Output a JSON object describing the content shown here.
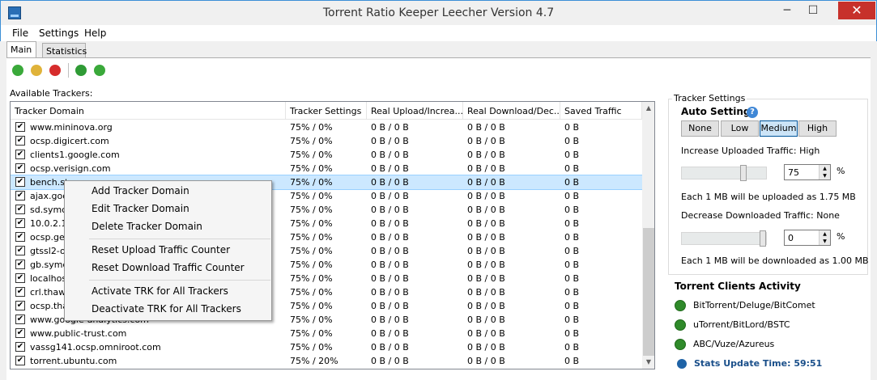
{
  "window": {
    "title": "Torrent Ratio Keeper Leecher Version 4.7",
    "minimize": "─",
    "maximize": "☐",
    "close": "✕"
  },
  "menu": [
    "File",
    "Settings",
    "Help"
  ],
  "tabs": [
    "Main",
    "Statistics"
  ],
  "available_trackers_label": "Available Trackers:",
  "table": {
    "columns": [
      "Tracker Domain",
      "Tracker Settings",
      "Real Upload/Increa...",
      "Real Download/Dec...",
      "Saved Traffic"
    ],
    "rows": [
      [
        "www.mininova.org",
        "75% / 0%",
        "0 B / 0 B",
        "0 B / 0 B",
        "0 B"
      ],
      [
        "ocsp.digicert.com",
        "75% / 0%",
        "0 B / 0 B",
        "0 B / 0 B",
        "0 B"
      ],
      [
        "clients1.google.com",
        "75% / 0%",
        "0 B / 0 B",
        "0 B / 0 B",
        "0 B"
      ],
      [
        "ocsp.verisign.com",
        "75% / 0%",
        "0 B / 0 B",
        "0 B / 0 B",
        "0 B"
      ],
      [
        "bench.st",
        "75% / 0%",
        "0 B / 0 B",
        "0 B / 0 B",
        "0 B"
      ],
      [
        "ajax.goo",
        "75% / 0%",
        "0 B / 0 B",
        "0 B / 0 B",
        "0 B"
      ],
      [
        "sd.symco",
        "75% / 0%",
        "0 B / 0 B",
        "0 B / 0 B",
        "0 B"
      ],
      [
        "10.0.2.1",
        "75% / 0%",
        "0 B / 0 B",
        "0 B / 0 B",
        "0 B"
      ],
      [
        "ocsp.geo",
        "75% / 0%",
        "0 B / 0 B",
        "0 B / 0 B",
        "0 B"
      ],
      [
        "gtssl2-oc",
        "75% / 0%",
        "0 B / 0 B",
        "0 B / 0 B",
        "0 B"
      ],
      [
        "gb.symco",
        "75% / 0%",
        "0 B / 0 B",
        "0 B / 0 B",
        "0 B"
      ],
      [
        "localhost",
        "75% / 0%",
        "0 B / 0 B",
        "0 B / 0 B",
        "0 B"
      ],
      [
        "crl.thawt",
        "75% / 0%",
        "0 B / 0 B",
        "0 B / 0 B",
        "0 B"
      ],
      [
        "ocsp.tha",
        "75% / 0%",
        "0 B / 0 B",
        "0 B / 0 B",
        "0 B"
      ],
      [
        "www.google-analytics.com",
        "75% / 0%",
        "0 B / 0 B",
        "0 B / 0 B",
        "0 B"
      ],
      [
        "www.public-trust.com",
        "75% / 0%",
        "0 B / 0 B",
        "0 B / 0 B",
        "0 B"
      ],
      [
        "vassg141.ocsp.omniroot.com",
        "75% / 0%",
        "0 B / 0 B",
        "0 B / 0 B",
        "0 B"
      ],
      [
        "torrent.ubuntu.com",
        "75% / 20%",
        "0 B / 0 B",
        "0 B / 0 B",
        "0 B"
      ]
    ],
    "checkmark": "✔"
  },
  "context_menu": {
    "items": [
      "Add Tracker Domain",
      "Edit Tracker Domain",
      "Delete Tracker Domain",
      "Reset Upload Traffic Counter",
      "Reset Download Traffic Counter",
      "Activate TRK for All Trackers",
      "Deactivate TRK for All Trackers"
    ]
  },
  "tracker_settings": {
    "legend": "Tracker Settings",
    "auto_label": "Auto Settings",
    "help": "?",
    "presets": [
      "None",
      "Low",
      "Medium",
      "High"
    ],
    "upload_label": "Increase Uploaded Traffic: High",
    "upload_value": "75",
    "upload_level": 0.75,
    "upload_info": "Each 1 MB will be uploaded as 1.75 MB",
    "download_label": "Decrease Downloaded Traffic: None",
    "download_value": "0",
    "download_level": 1.0,
    "download_info": "Each 1 MB will be downloaded as 1.00 MB",
    "percent": "%"
  },
  "clients": {
    "title": "Torrent Clients Activity",
    "items": [
      "BitTorrent/Deluge/BitComet",
      "uTorrent/BitLord/BSTC",
      "ABC/Vuze/Azureus"
    ]
  },
  "stats_update": "Stats Update Time: 59:51"
}
